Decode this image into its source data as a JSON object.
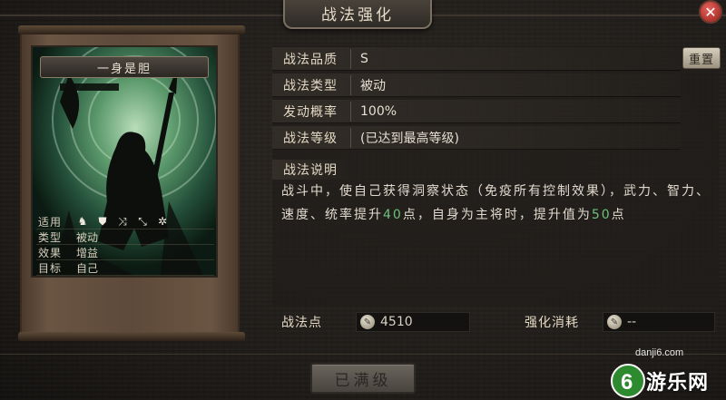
{
  "window": {
    "title": "战法强化",
    "close_label": "✕"
  },
  "card": {
    "name": "一身是胆",
    "rows": [
      {
        "key": "适用",
        "icons": [
          "cavalry-icon",
          "shield-icon",
          "archer-icon",
          "spear-icon",
          "wheel-icon"
        ]
      },
      {
        "key": "类型",
        "value": "被动"
      },
      {
        "key": "效果",
        "value": "增益"
      },
      {
        "key": "目标",
        "value": "自己"
      }
    ]
  },
  "stats": [
    {
      "label": "战法品质",
      "value": "S"
    },
    {
      "label": "战法类型",
      "value": "被动"
    },
    {
      "label": "发动概率",
      "value": "100%"
    },
    {
      "label": "战法等级",
      "value": "(已达到最高等级)"
    }
  ],
  "reset_label": "重置",
  "description": {
    "title": "战法说明",
    "part1": "战斗中，使自己获得洞察状态（免疫所有控制效果），武力、智力、速度、统率提升",
    "value1": "40",
    "part2": "点，自身为主将时，提升值为",
    "value2": "50",
    "part3": "点"
  },
  "resources": {
    "points_label": "战法点",
    "points_value": "4510",
    "cost_label": "强化消耗",
    "cost_value": "--"
  },
  "maxed_label": "已满级",
  "watermark": {
    "site": "danji6.com",
    "name": "游乐网"
  },
  "colors": {
    "highlight": "#6cc27a",
    "close": "#c23a34"
  }
}
